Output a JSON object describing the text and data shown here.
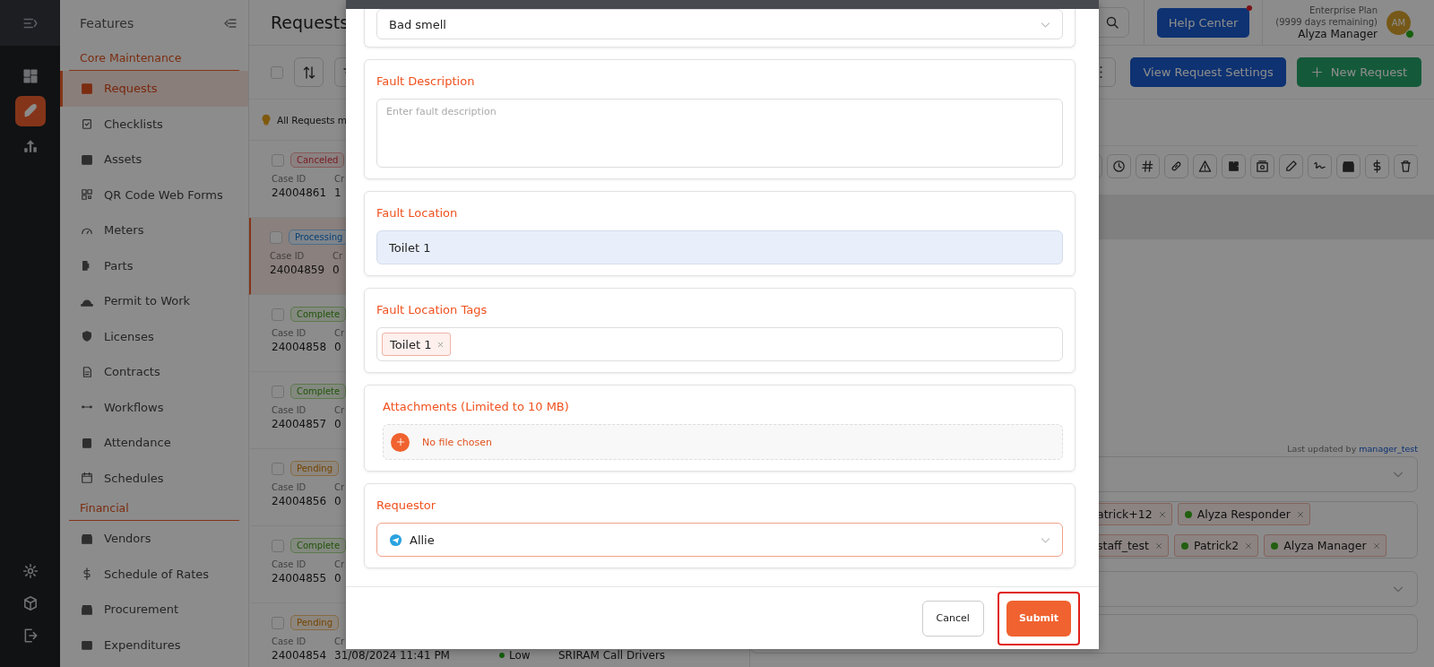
{
  "features": {
    "title": "Features",
    "sections": [
      {
        "heading": "Core Maintenance",
        "items": [
          {
            "label": "Requests",
            "selected": true
          },
          {
            "label": "Checklists",
            "selected": false
          },
          {
            "label": "Assets",
            "selected": false
          },
          {
            "label": "QR Code Web Forms",
            "selected": false
          },
          {
            "label": "Meters",
            "selected": false
          },
          {
            "label": "Parts",
            "selected": false
          },
          {
            "label": "Permit to Work",
            "selected": false
          },
          {
            "label": "Licenses",
            "selected": false
          },
          {
            "label": "Contracts",
            "selected": false
          },
          {
            "label": "Workflows",
            "selected": false
          },
          {
            "label": "Attendance",
            "selected": false
          },
          {
            "label": "Schedules",
            "selected": false
          }
        ]
      },
      {
        "heading": "Financial",
        "items": [
          {
            "label": "Vendors",
            "selected": false
          },
          {
            "label": "Schedule of Rates",
            "selected": false
          },
          {
            "label": "Procurement",
            "selected": false
          },
          {
            "label": "Expenditures",
            "selected": false
          }
        ]
      }
    ]
  },
  "page": {
    "title": "Requests"
  },
  "topbar": {
    "help": "Help Center",
    "plan": "Enterprise Plan",
    "remaining": "(9999 days remaining)",
    "user": "Alyza Manager",
    "avatar": "AM"
  },
  "actions": {
    "settings": "View Request Settings",
    "new": "New Request"
  },
  "list": {
    "notice": "All Requests m",
    "select_all": {
      "checked": false
    },
    "items": [
      {
        "status": "Canceled",
        "kind": "canceled",
        "checked": false,
        "selected": false,
        "case_label": "Case ID",
        "case_id": "24004861",
        "column_2_label": "Cr",
        "column_2_value": "1"
      },
      {
        "status": "Processing",
        "kind": "processing",
        "checked": false,
        "selected": true,
        "case_label": "Case ID",
        "case_id": "24004859",
        "column_2_label": "Cr",
        "column_2_value": "0"
      },
      {
        "status": "Complete",
        "kind": "complete",
        "checked": false,
        "selected": false,
        "case_label": "Case ID",
        "case_id": "24004858",
        "column_2_label": "Cr",
        "column_2_value": "0"
      },
      {
        "status": "Complete",
        "kind": "complete",
        "checked": false,
        "selected": false,
        "case_label": "Case ID",
        "case_id": "24004857",
        "column_2_label": "Cr",
        "column_2_value": "0"
      },
      {
        "status": "Pending",
        "kind": "pending",
        "checked": false,
        "selected": false,
        "case_label": "Case ID",
        "case_id": "24004856",
        "column_2_label": "Cr",
        "column_2_value": "0"
      },
      {
        "status": "Complete",
        "kind": "complete",
        "checked": false,
        "selected": false,
        "case_label": "Case ID",
        "case_id": "24004855",
        "column_2_label": "Cr",
        "column_2_value": "0"
      },
      {
        "status": "Pending",
        "kind": "pending",
        "checked": false,
        "selected": false,
        "case_label": "Case ID",
        "case_id": "24004854",
        "column_2_label": "Cr",
        "column_2_value": "31/08/2024 11:41 PM",
        "priority": "Low",
        "assignee": "SRIRAM Call Drivers"
      }
    ]
  },
  "detail": {
    "updated_prefix": "Last updated by",
    "updated_by": "manager_test",
    "tags": [
      {
        "label": "atrick+12"
      },
      {
        "label": "Alyza Responder",
        "online": true
      },
      {
        "label": "staff_test"
      },
      {
        "label": "Patrick2",
        "online": true
      },
      {
        "label": "Alyza Manager",
        "online": true
      }
    ]
  },
  "modal": {
    "fields": [
      {
        "kind": "select",
        "value": "Bad smell"
      },
      {
        "kind": "textarea",
        "label": "Fault Description",
        "placeholder": "Enter fault description"
      },
      {
        "kind": "input",
        "label": "Fault Location",
        "value": "Toilet 1"
      },
      {
        "kind": "tags",
        "label": "Fault Location Tags",
        "tags": [
          "Toilet 1"
        ]
      },
      {
        "kind": "file",
        "label": "Attachments (Limited to 10 MB)",
        "value": "No file chosen"
      },
      {
        "kind": "select",
        "label": "Requestor",
        "value": "Allie"
      }
    ],
    "buttons": [
      {
        "label": "Cancel",
        "kind": "secondary",
        "highlighted": false
      },
      {
        "label": "Submit",
        "kind": "primary",
        "highlighted": true
      }
    ]
  }
}
